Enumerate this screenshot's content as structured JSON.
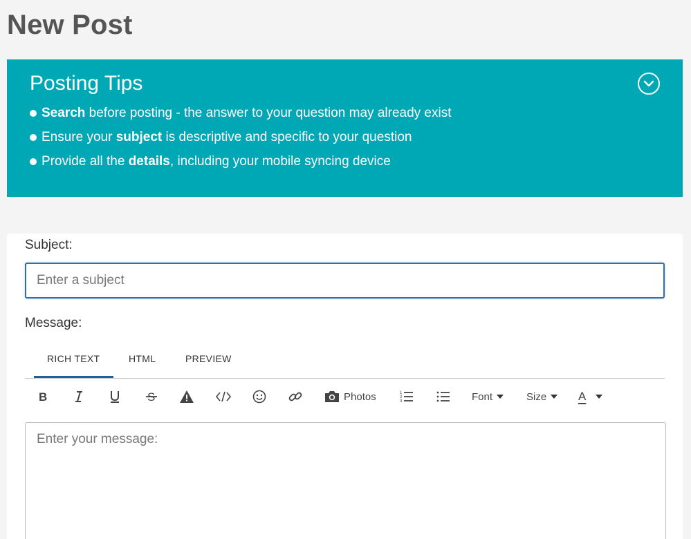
{
  "page": {
    "title": "New Post"
  },
  "tips": {
    "title": "Posting Tips",
    "toggle_icon": "chevron-down-circle-icon",
    "items": [
      {
        "bold": "Search",
        "rest": " before posting - the answer to your question may already exist"
      },
      {
        "pre": "Ensure your ",
        "bold": "subject",
        "rest": " is descriptive and specific to your question"
      },
      {
        "pre": "Provide all the ",
        "bold": "details",
        "rest": ", including your mobile syncing device"
      }
    ],
    "colors": {
      "background": "#00a8b5",
      "text": "#ffffff"
    }
  },
  "form": {
    "subject_label": "Subject:",
    "subject_placeholder": "Enter a subject",
    "subject_value": "",
    "message_label": "Message:",
    "message_placeholder": "Enter your message:",
    "message_value": ""
  },
  "editor": {
    "tabs": [
      {
        "label": "RICH TEXT",
        "active": true
      },
      {
        "label": "HTML",
        "active": false
      },
      {
        "label": "PREVIEW",
        "active": false
      }
    ],
    "toolbar": {
      "bold_icon": "bold-icon",
      "italic_icon": "italic-icon",
      "underline_icon": "underline-icon",
      "strikethrough_icon": "strikethrough-icon",
      "spoiler_icon": "warning-icon",
      "code_icon": "code-icon",
      "emoji_icon": "smiley-icon",
      "link_icon": "link-icon",
      "photos_icon": "camera-icon",
      "photos_label": "Photos",
      "numbered_list_icon": "numbered-list-icon",
      "bullet_list_icon": "bullet-list-icon",
      "font_label": "Font",
      "size_label": "Size",
      "color_label": "A"
    },
    "accent": "#1f5fa0"
  }
}
